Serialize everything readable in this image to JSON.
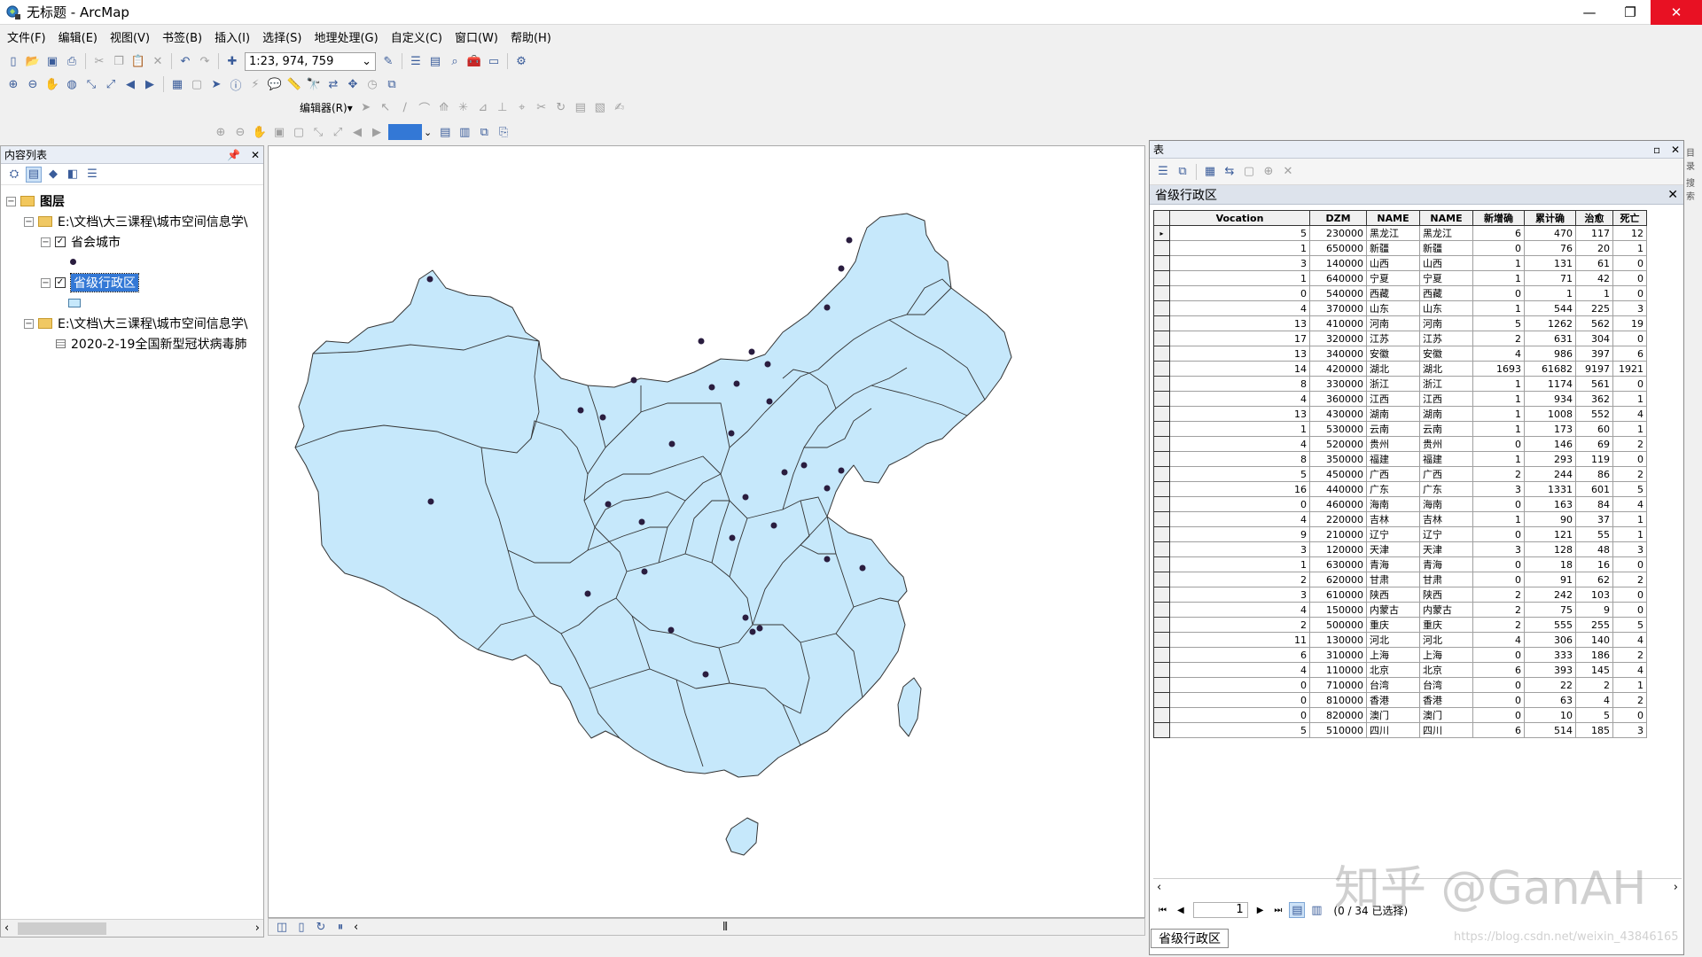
{
  "window": {
    "title": "无标题 - ArcMap",
    "minimize": "—",
    "maximize": "❐",
    "close": "✕"
  },
  "menu": [
    "文件(F)",
    "编辑(E)",
    "视图(V)",
    "书签(B)",
    "插入(I)",
    "选择(S)",
    "地理处理(G)",
    "自定义(C)",
    "窗口(W)",
    "帮助(H)"
  ],
  "toolbar": {
    "scale_value": "1:23, 974, 759",
    "editor_label": "编辑器(R)▾"
  },
  "toc": {
    "title": "内容列表",
    "pin": "ᵖ",
    "close": "✕",
    "root_label": "图层",
    "group1_path": "E:\\文档\\大三课程\\城市空间信息学\\",
    "layer_city": "省会城市",
    "layer_province": "省级行政区",
    "group2_path": "E:\\文档\\大三课程\\城市空间信息学\\",
    "table_entry": "2020-2-19全国新型冠状病毒肺"
  },
  "attr": {
    "window_title": "表",
    "layer_tab": "省级行政区",
    "columns": [
      "Vocation",
      "DZM",
      "NAME",
      "NAME",
      "新增确",
      "累计确",
      "治愈",
      "死亡"
    ],
    "rows": [
      [
        "5",
        "230000",
        "黑龙江",
        "黑龙江",
        "6",
        "470",
        "117",
        "12"
      ],
      [
        "1",
        "650000",
        "新疆",
        "新疆",
        "0",
        "76",
        "20",
        "1"
      ],
      [
        "3",
        "140000",
        "山西",
        "山西",
        "1",
        "131",
        "61",
        "0"
      ],
      [
        "1",
        "640000",
        "宁夏",
        "宁夏",
        "1",
        "71",
        "42",
        "0"
      ],
      [
        "0",
        "540000",
        "西藏",
        "西藏",
        "0",
        "1",
        "1",
        "0"
      ],
      [
        "4",
        "370000",
        "山东",
        "山东",
        "1",
        "544",
        "225",
        "3"
      ],
      [
        "13",
        "410000",
        "河南",
        "河南",
        "5",
        "1262",
        "562",
        "19"
      ],
      [
        "17",
        "320000",
        "江苏",
        "江苏",
        "2",
        "631",
        "304",
        "0"
      ],
      [
        "13",
        "340000",
        "安徽",
        "安徽",
        "4",
        "986",
        "397",
        "6"
      ],
      [
        "14",
        "420000",
        "湖北",
        "湖北",
        "1693",
        "61682",
        "9197",
        "1921"
      ],
      [
        "8",
        "330000",
        "浙江",
        "浙江",
        "1",
        "1174",
        "561",
        "0"
      ],
      [
        "4",
        "360000",
        "江西",
        "江西",
        "1",
        "934",
        "362",
        "1"
      ],
      [
        "13",
        "430000",
        "湖南",
        "湖南",
        "1",
        "1008",
        "552",
        "4"
      ],
      [
        "1",
        "530000",
        "云南",
        "云南",
        "1",
        "173",
        "60",
        "1"
      ],
      [
        "4",
        "520000",
        "贵州",
        "贵州",
        "0",
        "146",
        "69",
        "2"
      ],
      [
        "8",
        "350000",
        "福建",
        "福建",
        "1",
        "293",
        "119",
        "0"
      ],
      [
        "5",
        "450000",
        "广西",
        "广西",
        "2",
        "244",
        "86",
        "2"
      ],
      [
        "16",
        "440000",
        "广东",
        "广东",
        "3",
        "1331",
        "601",
        "5"
      ],
      [
        "0",
        "460000",
        "海南",
        "海南",
        "0",
        "163",
        "84",
        "4"
      ],
      [
        "4",
        "220000",
        "吉林",
        "吉林",
        "1",
        "90",
        "37",
        "1"
      ],
      [
        "9",
        "210000",
        "辽宁",
        "辽宁",
        "0",
        "121",
        "55",
        "1"
      ],
      [
        "3",
        "120000",
        "天津",
        "天津",
        "3",
        "128",
        "48",
        "3"
      ],
      [
        "1",
        "630000",
        "青海",
        "青海",
        "0",
        "18",
        "16",
        "0"
      ],
      [
        "2",
        "620000",
        "甘肃",
        "甘肃",
        "0",
        "91",
        "62",
        "2"
      ],
      [
        "3",
        "610000",
        "陕西",
        "陕西",
        "2",
        "242",
        "103",
        "0"
      ],
      [
        "4",
        "150000",
        "内蒙古",
        "内蒙古",
        "2",
        "75",
        "9",
        "0"
      ],
      [
        "2",
        "500000",
        "重庆",
        "重庆",
        "2",
        "555",
        "255",
        "5"
      ],
      [
        "11",
        "130000",
        "河北",
        "河北",
        "4",
        "306",
        "140",
        "4"
      ],
      [
        "6",
        "310000",
        "上海",
        "上海",
        "0",
        "333",
        "186",
        "2"
      ],
      [
        "4",
        "110000",
        "北京",
        "北京",
        "6",
        "393",
        "145",
        "4"
      ],
      [
        "0",
        "710000",
        "台湾",
        "台湾",
        "0",
        "22",
        "2",
        "1"
      ],
      [
        "0",
        "810000",
        "香港",
        "香港",
        "0",
        "63",
        "4",
        "2"
      ],
      [
        "0",
        "820000",
        "澳门",
        "澳门",
        "0",
        "10",
        "5",
        "0"
      ],
      [
        "5",
        "510000",
        "四川",
        "四川",
        "6",
        "514",
        "185",
        "3"
      ]
    ],
    "record_number": "1",
    "selection_status": "(0 / 34 已选择)",
    "bottom_tab": "省级行政区"
  },
  "watermark": "知乎 @GanAH",
  "watermark_url": "https://blog.csdn.net/weixin_43846165",
  "colors": {
    "province_fill": "#c6e8fb",
    "city_point": "#2a1d3f",
    "selection": "#3378d6"
  }
}
